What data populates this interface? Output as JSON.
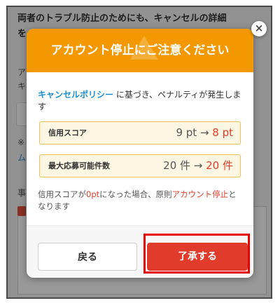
{
  "background": {
    "line1": "両者のトラブル防止のためにも、キャンセルの詳細",
    "line2": "を",
    "fragments": [
      "ア",
      "キ",
      "※",
      "ム",
      "事"
    ]
  },
  "modal": {
    "title": "アカウント停止にご注意ください",
    "close_label": "×",
    "description": {
      "link": "キャンセルポリシー",
      "text": " に基づき、ペナルティが発生します"
    },
    "rows": [
      {
        "label": "信用スコア",
        "old": "9 pt",
        "arrow": " → ",
        "new": "8 pt"
      },
      {
        "label": "最大応募可能件数",
        "old": "20 件",
        "arrow": " → ",
        "new": "20 件"
      }
    ],
    "note": {
      "part1": "信用スコアが",
      "red1": "0pt",
      "part2": "になった場合、原則",
      "red2": "アカウント停止",
      "part3": "となります"
    },
    "buttons": {
      "back": "戻る",
      "accept": "了承する"
    }
  },
  "colors": {
    "header": "#f39800",
    "accent_red": "#e13c2b",
    "link_blue": "#1a8fd6",
    "highlight_border": "#e60000"
  }
}
